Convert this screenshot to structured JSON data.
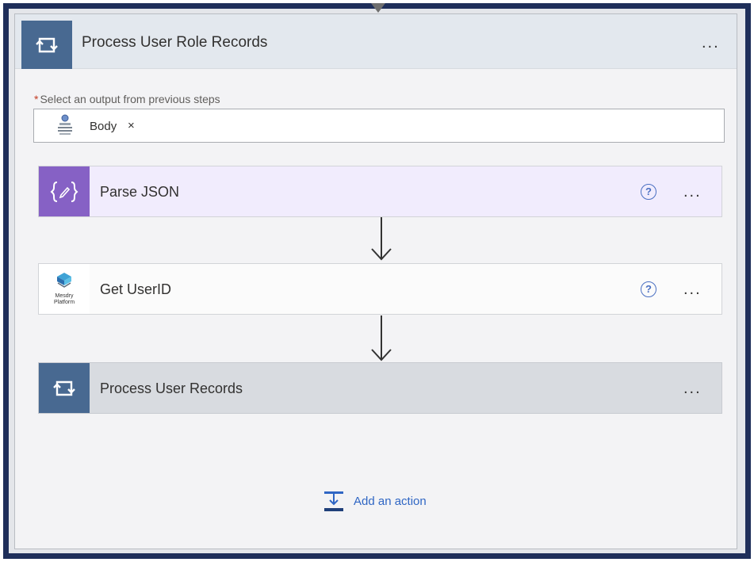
{
  "scope": {
    "title": "Process User Role Records",
    "menu": "..."
  },
  "output_field": {
    "required_marker": "*",
    "label": "Select an output from previous steps",
    "token": {
      "label": "Body",
      "remove_glyph": "×",
      "icon": "app-connector-icon"
    }
  },
  "actions": [
    {
      "title": "Parse JSON",
      "icon": "data-operation-icon",
      "help": "?",
      "menu": "...",
      "accent": "#8661c5"
    },
    {
      "title": "Get UserID",
      "icon": "mesdry-platform-icon",
      "help": "?",
      "menu": "...",
      "icon_caption": "Mesdry Platform"
    },
    {
      "title": "Process User Records",
      "icon": "loop-icon",
      "menu": "...",
      "accent": "#486991"
    }
  ],
  "add_action": {
    "label": "Add an action"
  }
}
